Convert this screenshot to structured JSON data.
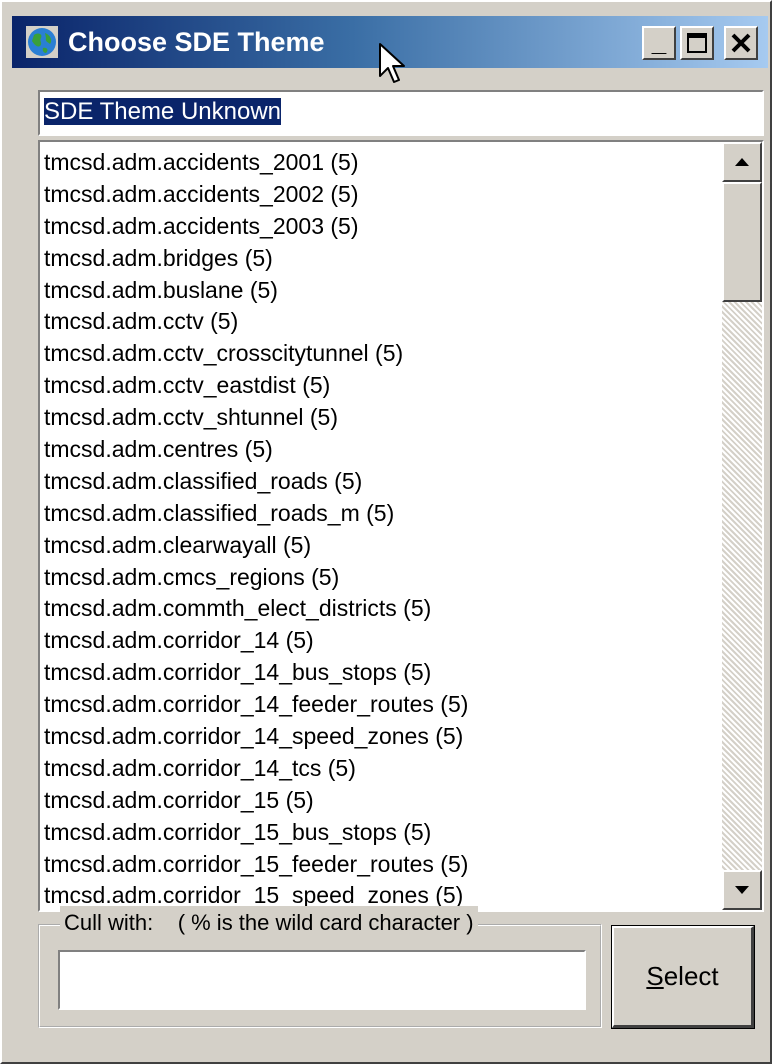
{
  "window": {
    "title": "Choose SDE Theme",
    "title_icon": "globe-icon"
  },
  "theme_field": {
    "value": "SDE Theme Unknown"
  },
  "theme_list": {
    "items": [
      "tmcsd.adm.accidents_2001 (5)",
      "tmcsd.adm.accidents_2002 (5)",
      "tmcsd.adm.accidents_2003 (5)",
      "tmcsd.adm.bridges (5)",
      "tmcsd.adm.buslane (5)",
      "tmcsd.adm.cctv (5)",
      "tmcsd.adm.cctv_crosscitytunnel (5)",
      "tmcsd.adm.cctv_eastdist (5)",
      "tmcsd.adm.cctv_shtunnel (5)",
      "tmcsd.adm.centres (5)",
      "tmcsd.adm.classified_roads (5)",
      "tmcsd.adm.classified_roads_m (5)",
      "tmcsd.adm.clearwayall (5)",
      "tmcsd.adm.cmcs_regions (5)",
      "tmcsd.adm.commth_elect_districts (5)",
      "tmcsd.adm.corridor_14 (5)",
      "tmcsd.adm.corridor_14_bus_stops (5)",
      "tmcsd.adm.corridor_14_feeder_routes (5)",
      "tmcsd.adm.corridor_14_speed_zones (5)",
      "tmcsd.adm.corridor_14_tcs (5)",
      "tmcsd.adm.corridor_15 (5)",
      "tmcsd.adm.corridor_15_bus_stops (5)",
      "tmcsd.adm.corridor_15_feeder_routes (5)",
      "tmcsd.adm.corridor_15_speed_zones (5)"
    ]
  },
  "cull": {
    "legend": "Cull with:    ( % is the wild card character )",
    "value": ""
  },
  "select_button": {
    "mnemonic": "S",
    "rest": "elect"
  },
  "caption_buttons": {
    "minimize": "_",
    "close": "✕"
  },
  "colors": {
    "titlebar_start": "#0a246a",
    "titlebar_end": "#a6caf0",
    "selection": "#0a246a",
    "face": "#d4d0c8"
  }
}
